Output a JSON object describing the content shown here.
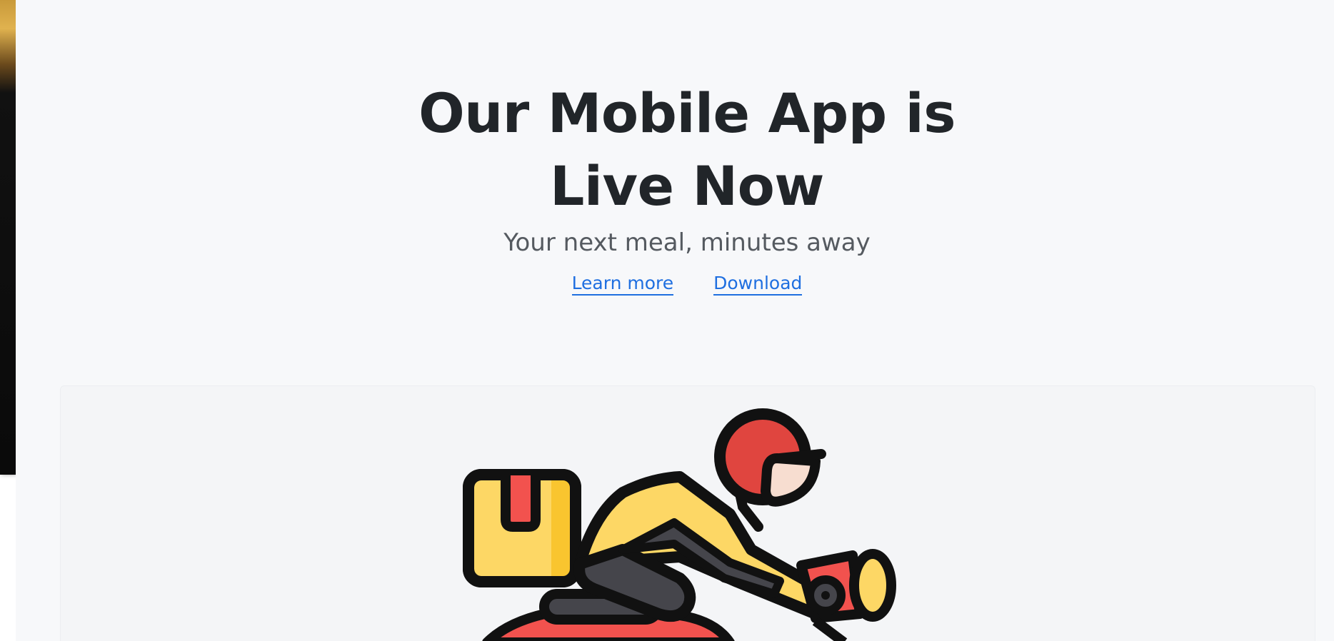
{
  "hero": {
    "title": "Our Mobile App is Live Now",
    "subtitle": "Your next meal, minutes away"
  },
  "links": {
    "learn_more": "Learn more",
    "download": "Download"
  },
  "illustration": {
    "icon": "delivery-rider-icon",
    "colors": {
      "helmet": "#e0453f",
      "jacket": "#fdd765",
      "box": "#fdd765",
      "box_tape": "#f2524e",
      "pants": "#45454b",
      "scooter": "#f2524e",
      "outline": "#111111"
    }
  },
  "colors": {
    "background": "#f7f8fa",
    "title": "#212529",
    "subtitle": "#555a60",
    "link": "#1f6fe0"
  }
}
